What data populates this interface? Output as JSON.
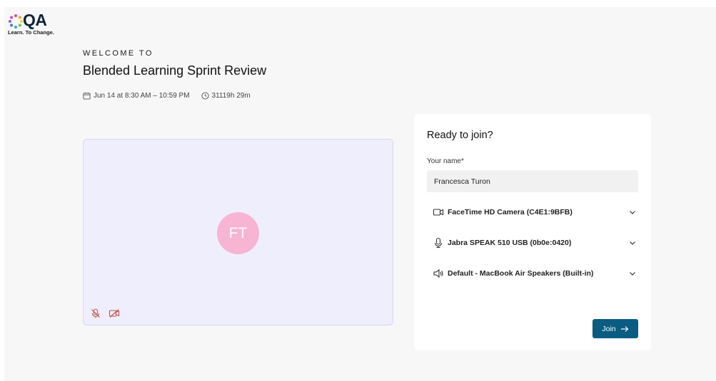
{
  "brand": {
    "name": "QA",
    "tagline": "Learn. To Change."
  },
  "header": {
    "welcome": "WELCOME TO",
    "title": "Blended Learning Sprint Review",
    "date": "Jun 14 at 8:30 AM – 10:59 PM",
    "duration": "31119h 29m"
  },
  "preview": {
    "initials": "FT",
    "avatar_color": "#f8b4d3",
    "icons": [
      "mic-off-icon",
      "camera-off-icon"
    ]
  },
  "join": {
    "title": "Ready to join?",
    "name_label": "Your name*",
    "name_value": "Francesca Turon",
    "devices": [
      {
        "icon": "camera-icon",
        "label": "FaceTime HD Camera (C4E1:9BFB)"
      },
      {
        "icon": "microphone-icon",
        "label": "Jabra SPEAK 510 USB (0b0e:0420)"
      },
      {
        "icon": "speaker-icon",
        "label": "Default - MacBook Air Speakers (Built-in)"
      }
    ],
    "button_label": "Join",
    "button_color": "#0a5d81"
  }
}
